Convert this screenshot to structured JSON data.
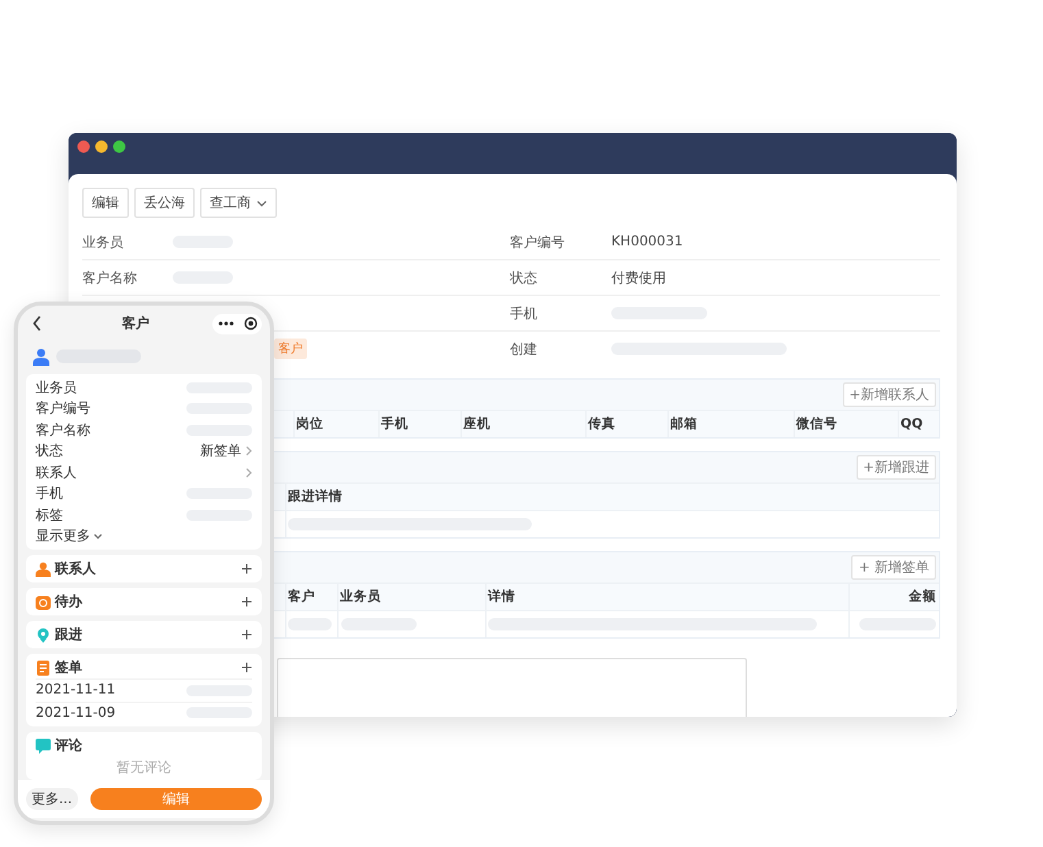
{
  "desktop": {
    "toolbar": [
      {
        "label": "编辑",
        "kind": "button"
      },
      {
        "label": "丢公海",
        "kind": "button"
      },
      {
        "label": "查工商",
        "kind": "dropdown"
      }
    ],
    "rows": [
      {
        "left": {
          "label": "业务员",
          "kind": "skeleton"
        },
        "right": {
          "label": "客户编号",
          "kind": "text",
          "value": "KH000031"
        }
      },
      {
        "left": {
          "label": "客户名称",
          "kind": "skeleton"
        },
        "right": {
          "label": "状态",
          "kind": "text",
          "value": "付费使用"
        }
      },
      {
        "right": {
          "label": "手机",
          "kind": "skeleton"
        }
      },
      {
        "left": {
          "kind": "tag",
          "value": "客户"
        },
        "right": {
          "label": "创建",
          "kind": "skeleton"
        }
      }
    ],
    "sections": [
      {
        "add_button": "+新增联系人",
        "columns": [
          "岗位",
          "手机",
          "座机",
          "传真",
          "邮箱",
          "微信号",
          "QQ"
        ]
      },
      {
        "add_button": "+新增跟进",
        "columns": [
          "跟进详情"
        ],
        "rows": [
          {
            "kind": "loading"
          }
        ]
      },
      {
        "add_button": "+ 新增签单",
        "columns": [
          "客户",
          "业务员",
          "详情",
          "金额"
        ],
        "rows": [
          {
            "kind": "loading"
          }
        ]
      }
    ]
  },
  "phone": {
    "title": "客户",
    "fields": [
      {
        "label": "业务员",
        "kind": "skeleton"
      },
      {
        "label": "客户编号",
        "kind": "skeleton"
      },
      {
        "label": "客户名称",
        "kind": "skeleton"
      },
      {
        "label": "状态",
        "kind": "link",
        "value": "新签单"
      },
      {
        "label": "联系人",
        "kind": "link"
      },
      {
        "label": "手机",
        "kind": "skeleton"
      },
      {
        "label": "标签",
        "kind": "skeleton"
      }
    ],
    "show_more": "显示更多",
    "sections": [
      {
        "title": "联系人",
        "color": "#f7801e"
      },
      {
        "title": "待办",
        "color": "#f7801e"
      },
      {
        "title": "跟进",
        "color": "#22c3c3"
      },
      {
        "title": "签单",
        "color": "#f7801e",
        "rows": [
          {
            "date": "2021-11-11"
          },
          {
            "date": "2021-11-09"
          }
        ]
      }
    ],
    "comments": {
      "title": "评论",
      "empty_text": "暂无评论"
    },
    "more_button": "更多...",
    "edit_button": "编辑"
  }
}
